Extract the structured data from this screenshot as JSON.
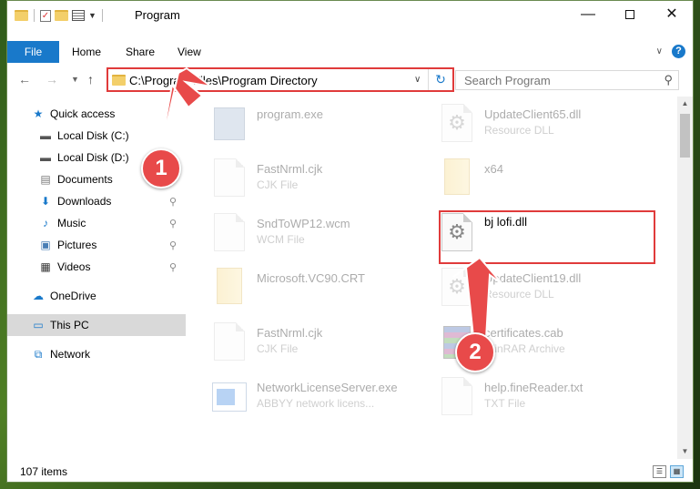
{
  "window": {
    "title": "Program",
    "controls": {
      "minimize": "—",
      "maximize": "",
      "close": "✕"
    }
  },
  "ribbon": {
    "tabs": {
      "file": "File",
      "home": "Home",
      "share": "Share",
      "view": "View"
    },
    "collapse": "∨",
    "help": "?"
  },
  "nav": {
    "back": "←",
    "forward": "→",
    "recent": "▼",
    "up": "↑",
    "address": "C:\\Program Files\\Program Directory",
    "address_dropdown": "∨",
    "refresh": "↻",
    "search_placeholder": "Search Program",
    "search_icon": "⚲"
  },
  "sidebar": {
    "items": [
      {
        "label": "Quick access",
        "icon": "★",
        "icon_name": "star-icon",
        "color": "#1979ca"
      },
      {
        "label": "Local Disk (C:)",
        "icon": "▬",
        "icon_name": "drive-c-icon",
        "color": "#555555"
      },
      {
        "label": "Local Disk (D:)",
        "icon": "▬",
        "icon_name": "drive-d-icon",
        "color": "#555555"
      },
      {
        "label": "Documents",
        "icon": "▤",
        "icon_name": "documents-icon",
        "color": "#777777"
      },
      {
        "label": "Downloads",
        "icon": "⬇",
        "icon_name": "downloads-icon",
        "color": "#1979ca"
      },
      {
        "label": "Music",
        "icon": "♪",
        "icon_name": "music-icon",
        "color": "#1979ca"
      },
      {
        "label": "Pictures",
        "icon": "▣",
        "icon_name": "pictures-icon",
        "color": "#4a7fb5"
      },
      {
        "label": "Videos",
        "icon": "▦",
        "icon_name": "videos-icon",
        "color": "#333333"
      },
      {
        "label": "OneDrive",
        "icon": "☁",
        "icon_name": "onedrive-icon",
        "color": "#1979ca"
      },
      {
        "label": "This PC",
        "icon": "▭",
        "icon_name": "this-pc-icon",
        "color": "#1979ca"
      },
      {
        "label": "Network",
        "icon": "⧉",
        "icon_name": "network-icon",
        "color": "#1979ca"
      }
    ],
    "pin": "⚲"
  },
  "files": [
    {
      "name": "program.exe",
      "type": "",
      "icon": "exe"
    },
    {
      "name": "UpdateClient65.dll",
      "type": "Resource DLL",
      "icon": "gear"
    },
    {
      "name": "FastNrml.cjk",
      "type": "CJK File",
      "icon": "doc"
    },
    {
      "name": "x64",
      "type": "",
      "icon": "folder"
    },
    {
      "name": "SndToWP12.wcm",
      "type": "WCM File",
      "icon": "doc"
    },
    {
      "name": "bj lofi.dll",
      "type": "",
      "icon": "gear"
    },
    {
      "name": "Microsoft.VC90.CRT",
      "type": "",
      "icon": "folder"
    },
    {
      "name": "UpdateClient19.dll",
      "type": "Resource DLL",
      "icon": "gear"
    },
    {
      "name": "FastNrml.cjk",
      "type": "CJK File",
      "icon": "doc"
    },
    {
      "name": "certificates.cab",
      "type": "WinRAR Archive",
      "icon": "rar"
    },
    {
      "name": "NetworkLicenseServer.exe",
      "type": "ABBYY network licens...",
      "icon": "net"
    },
    {
      "name": "help.fineReader.txt",
      "type": "TXT File",
      "icon": "doc"
    }
  ],
  "status": {
    "count": "107 items"
  },
  "callouts": {
    "one": "1",
    "two": "2"
  },
  "colors": {
    "accent": "#1979ca",
    "highlight": "#e03b3b",
    "callout": "#e84a4a"
  }
}
